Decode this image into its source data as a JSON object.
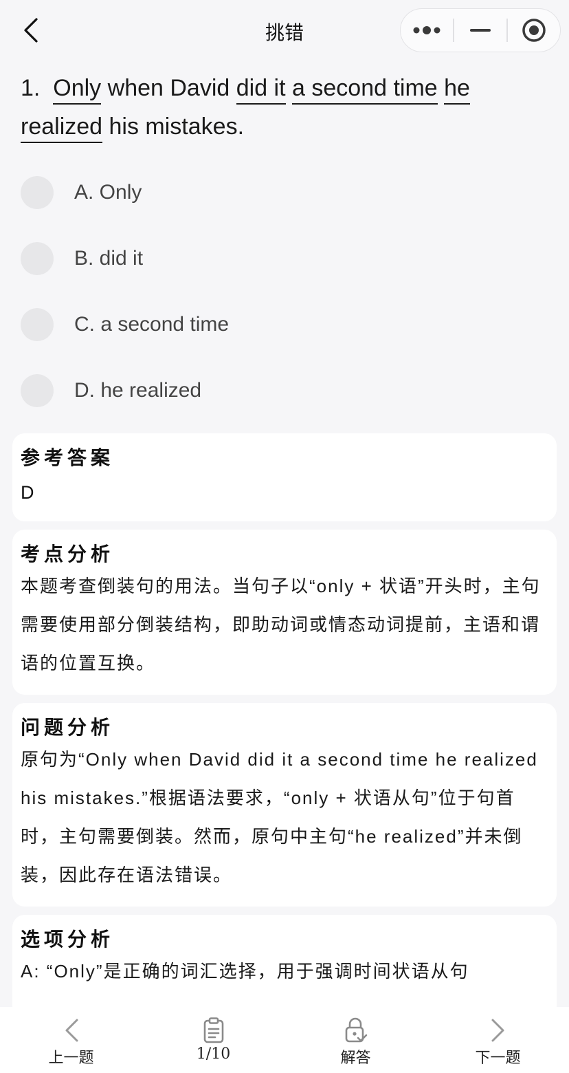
{
  "header": {
    "title": "挑错"
  },
  "question": {
    "number": "1.",
    "segments": [
      {
        "text": "Only",
        "underline": true
      },
      {
        "text": " when David ",
        "underline": false
      },
      {
        "text": "did it",
        "underline": true
      },
      {
        "text": " ",
        "underline": false
      },
      {
        "text": "a second time",
        "underline": true
      },
      {
        "text": " ",
        "underline": false
      },
      {
        "text": "he",
        "underline": true
      },
      {
        "text": " ",
        "underline": false
      },
      {
        "text": "realized",
        "underline": true
      },
      {
        "text": " his mistakes.",
        "underline": false
      }
    ]
  },
  "options": [
    {
      "label": "A. Only"
    },
    {
      "label": "B. did it"
    },
    {
      "label": "C. a second time"
    },
    {
      "label": "D. he realized"
    }
  ],
  "reference": {
    "title": "参考答案",
    "answer": "D"
  },
  "point_analysis": {
    "title": "考点分析",
    "text": "本题考查倒装句的用法。当句子以“only + 状语”开头时，主句需要使用部分倒装结构，即助动词或情态动词提前，主语和谓语的位置互换。"
  },
  "problem_analysis": {
    "title": "问题分析",
    "text": "原句为“Only when David did it a second time he realized his mistakes.”根据语法要求，“only + 状语从句”位于句首时，主句需要倒装。然而，原句中主句“he realized”并未倒装，因此存在语法错误。"
  },
  "option_analysis": {
    "title": "选项分析",
    "text": "A: “Only”是正确的词汇选择，用于强调时间状语从句"
  },
  "bottom_nav": {
    "prev": "上一题",
    "progress": "1/10",
    "answer": "解答",
    "next": "下一题"
  }
}
